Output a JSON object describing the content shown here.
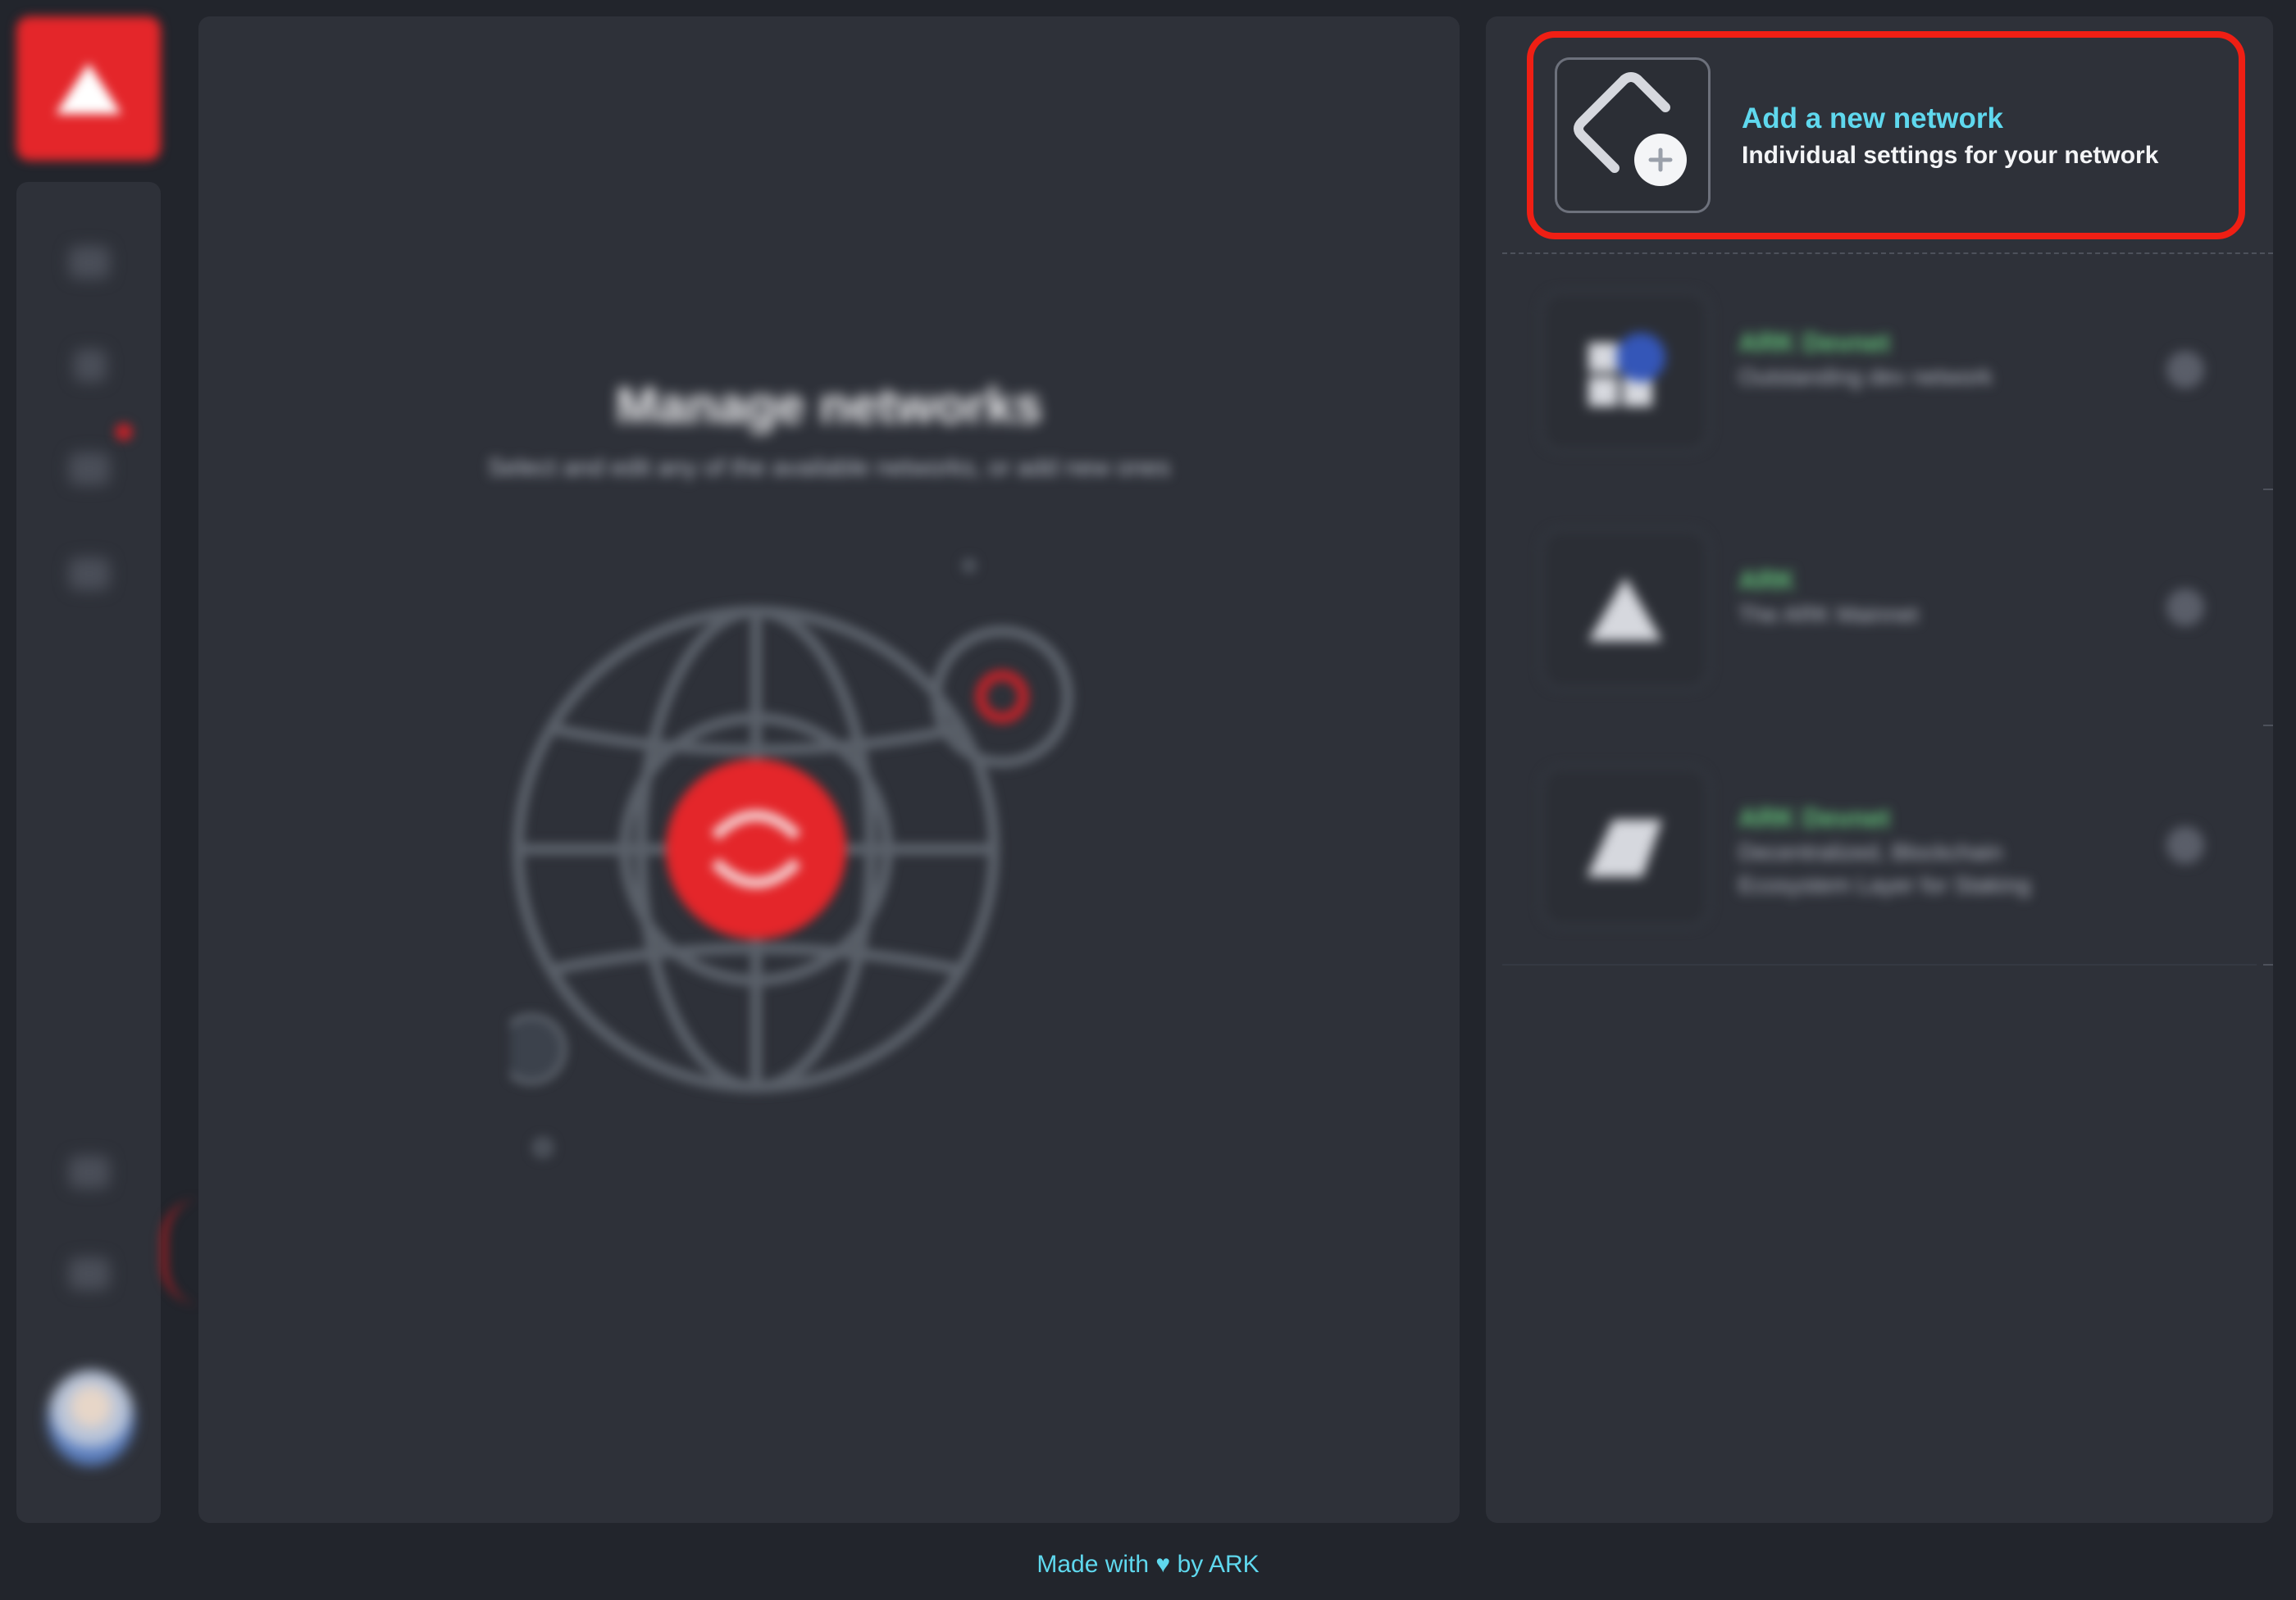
{
  "sidebar": {
    "logo_icon": "ark-logo-icon",
    "nav_icons": [
      "dashboard-icon",
      "wallet-icon",
      "contacts-icon",
      "messages-icon",
      "settings-icon",
      "network-icon"
    ],
    "avatar": "profile-avatar"
  },
  "main": {
    "title": "Manage networks",
    "subtitle": "Select and edit any of the available networks, or add new ones",
    "illustration": "globe-network-icon"
  },
  "add_network": {
    "title": "Add a new network",
    "subtitle": "Individual settings for your network",
    "icon": "add-network-icon"
  },
  "networks": [
    {
      "name": "ARK Devnet",
      "description": "Outstanding dev network",
      "icon": "ark-devnet-icon"
    },
    {
      "name": "ARK",
      "description": "The ARK Mainnet",
      "icon": "ark-mainnet-icon"
    },
    {
      "name": "ARK Devnet",
      "description": "Decentralized, Blockchain\nEcosystem Layer for Staking",
      "icon": "ark-network-icon"
    }
  ],
  "footer": {
    "prefix": "Made with",
    "heart": "♥",
    "suffix": "by ARK"
  },
  "colors": {
    "accent_red": "#e4262a",
    "highlight": "#ef1f14",
    "cyan": "#5fd8ee",
    "panel": "#2e3139",
    "background": "#22252c"
  }
}
